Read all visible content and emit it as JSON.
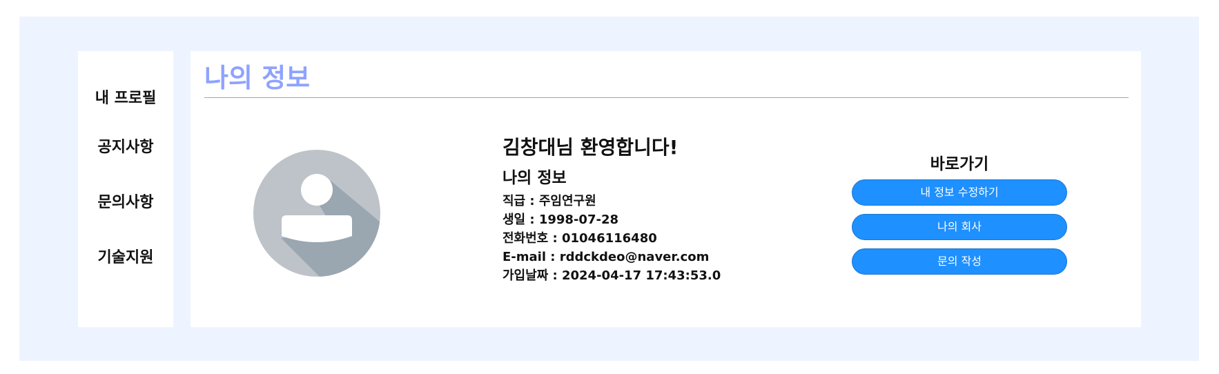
{
  "sidebar": {
    "items": [
      {
        "label": "내 프로필"
      },
      {
        "label": "공지사항"
      },
      {
        "label": "문의사항"
      },
      {
        "label": "기술지원"
      }
    ]
  },
  "main": {
    "title": "나의 정보",
    "avatar_icon": "default-user-avatar-icon",
    "welcome": "김창대님 환영합니다!",
    "info_heading": "나의 정보",
    "info_lines": [
      "직급 : 주임연구원",
      "생일 : 1998-07-28",
      "전화번호 : 01046116480",
      "E-mail : rddckdeo@naver.com",
      "가입날짜 : 2024-04-17 17:43:53.0"
    ]
  },
  "shortcuts": {
    "title": "바로가기",
    "buttons": [
      {
        "label": "내 정보 수정하기"
      },
      {
        "label": "나의 회사"
      },
      {
        "label": "문의 작성"
      }
    ]
  },
  "colors": {
    "page_background": "#eef4ff",
    "title": "#8ea2ff",
    "button": "#1e90ff",
    "avatar_circle": "#bdc3c8",
    "avatar_shadow": "#9aa6b0"
  }
}
